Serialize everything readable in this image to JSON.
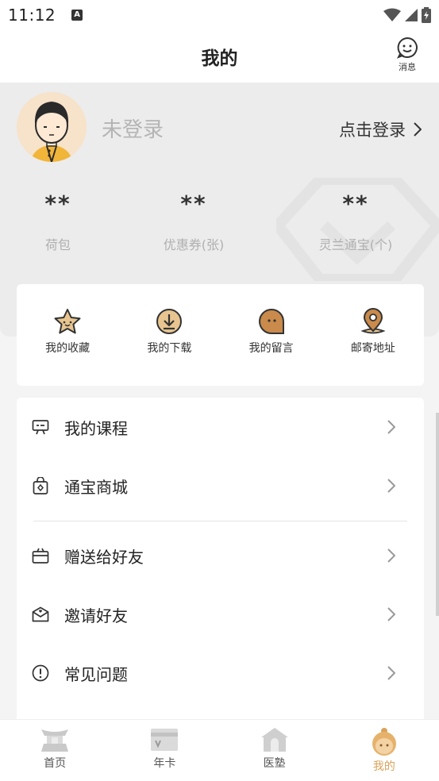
{
  "status_bar": {
    "time": "11:12",
    "badge": "A"
  },
  "header": {
    "title": "我的",
    "message_label": "消息"
  },
  "profile": {
    "name": "未登录",
    "login_link": "点击登录"
  },
  "stats": [
    {
      "value": "**",
      "label": "荷包"
    },
    {
      "value": "**",
      "label": "优惠券(张)"
    },
    {
      "value": "**",
      "label": "灵兰通宝(个)"
    }
  ],
  "quick_actions": [
    {
      "label": "我的收藏",
      "icon": "star-icon"
    },
    {
      "label": "我的下载",
      "icon": "download-icon"
    },
    {
      "label": "我的留言",
      "icon": "message-icon"
    },
    {
      "label": "邮寄地址",
      "icon": "location-icon"
    }
  ],
  "menu": [
    {
      "label": "我的课程",
      "icon": "course-icon"
    },
    {
      "label": "通宝商城",
      "icon": "shop-icon"
    },
    {
      "label": "赠送给好友",
      "icon": "gift-icon"
    },
    {
      "label": "邀请好友",
      "icon": "invite-icon"
    },
    {
      "label": "常见问题",
      "icon": "faq-icon"
    }
  ],
  "tabs": [
    {
      "label": "首页",
      "icon": "home-icon",
      "active": false
    },
    {
      "label": "年卡",
      "icon": "card-icon",
      "active": false
    },
    {
      "label": "医塾",
      "icon": "school-icon",
      "active": false
    },
    {
      "label": "我的",
      "icon": "profile-icon",
      "active": true
    }
  ],
  "colors": {
    "accent": "#d9a25a",
    "icon_brown": "#b0763c",
    "icon_fill": "#e8c590"
  }
}
